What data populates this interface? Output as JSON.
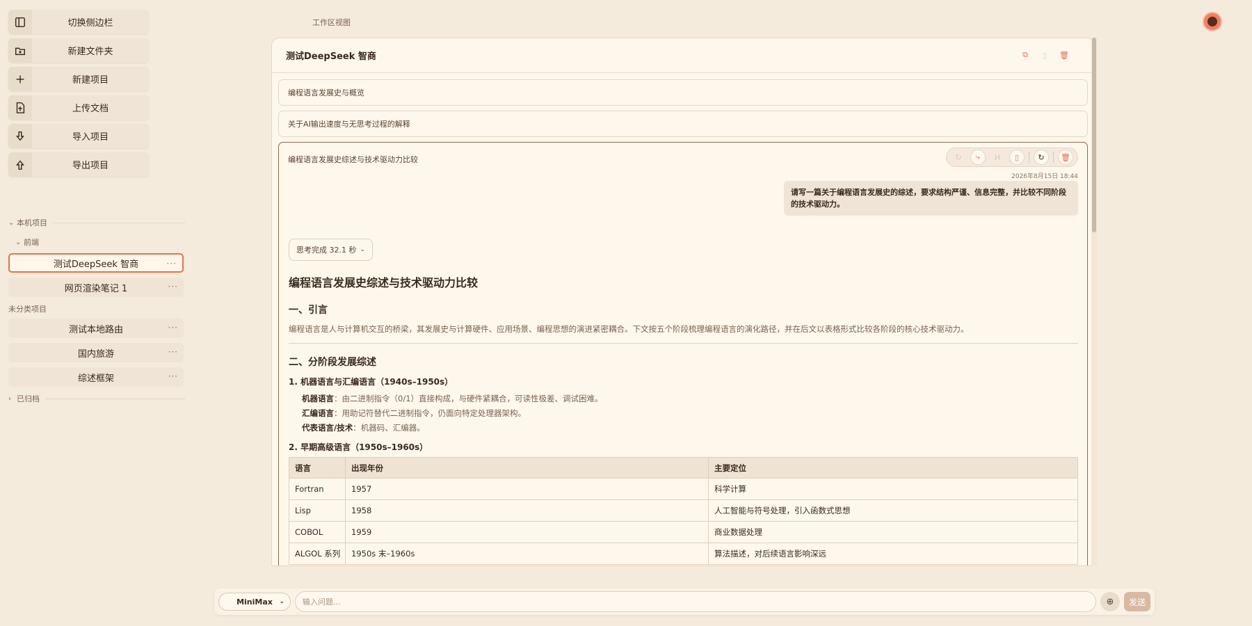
{
  "sidebar": {
    "buttons": [
      {
        "label": "切换侧边栏",
        "icon": "sidebar-toggle-icon"
      },
      {
        "label": "新建文件夹",
        "icon": "folder-plus-icon"
      },
      {
        "label": "新建项目",
        "icon": "plus-icon"
      },
      {
        "label": "上传文档",
        "icon": "file-upload-icon"
      },
      {
        "label": "导入项目",
        "icon": "arrow-down-icon"
      },
      {
        "label": "导出项目",
        "icon": "arrow-up-icon"
      }
    ],
    "local_section": "本机项目",
    "frontend_group": "前端",
    "frontend_projects": [
      "测试DeepSeek 智商",
      "网页渲染笔记 1"
    ],
    "uncategorized_section": "未分类项目",
    "uncategorized_projects": [
      "测试本地路由",
      "国内旅游",
      "综述框架"
    ],
    "archived_section": "已归档",
    "dots": "···"
  },
  "workspace_label": "工作区视图",
  "panel": {
    "title": "测试DeepSeek 智商",
    "conversations": [
      "编程语言发展史与概览",
      "关于AI输出速度与无思考过程的解释"
    ],
    "open_conversation": {
      "title": "编程语言发展史综述与技术驱动力比较",
      "timestamp": "2026年8月15日 18:44",
      "user_message": "请写一篇关于编程语言发展史的综述，要求结构严谨、信息完整，并比较不同阶段的技术驱动力。",
      "thinking": "思考完成 32.1 秒",
      "article": {
        "h1": "编程语言发展史综述与技术驱动力比较",
        "s1": "一、引言",
        "intro": "编程语言是人与计算机交互的桥梁，其发展史与计算硬件、应用场景、编程思想的演进紧密耦合。下文按五个阶段梳理编程语言的演化路径，并在后文以表格形式比较各阶段的核心技术驱动力。",
        "s2": "二、分阶段发展综述",
        "sub1": "1. 机器语言与汇编语言（1940s–1950s）",
        "items": [
          {
            "k": "机器语言",
            "v": "：由二进制指令（0/1）直接构成，与硬件紧耦合，可读性极差、调试困难。"
          },
          {
            "k": "汇编语言",
            "v": "：用助记符替代二进制指令，仍面向特定处理器架构。"
          },
          {
            "k": "代表语言/技术",
            "v": "：机器码、汇编器。"
          }
        ],
        "sub2": "2. 早期高级语言（1950s–1960s）",
        "table": {
          "headers": [
            "语言",
            "出现年份",
            "主要定位"
          ],
          "rows": [
            [
              "Fortran",
              "1957",
              "科学计算"
            ],
            [
              "Lisp",
              "1958",
              "人工智能与符号处理，引入函数式思想"
            ],
            [
              "COBOL",
              "1959",
              "商业数据处理"
            ],
            [
              "ALGOL 系列",
              "1950s 末–1960s",
              "算法描述，对后续语言影响深远"
            ]
          ]
        }
      }
    }
  },
  "input": {
    "model": "MiniMax",
    "placeholder": "输入问题...",
    "send": "发送"
  },
  "colors": {
    "accent": "#e8704d",
    "background": "#f5ebdd",
    "panel": "#fef7ec"
  }
}
